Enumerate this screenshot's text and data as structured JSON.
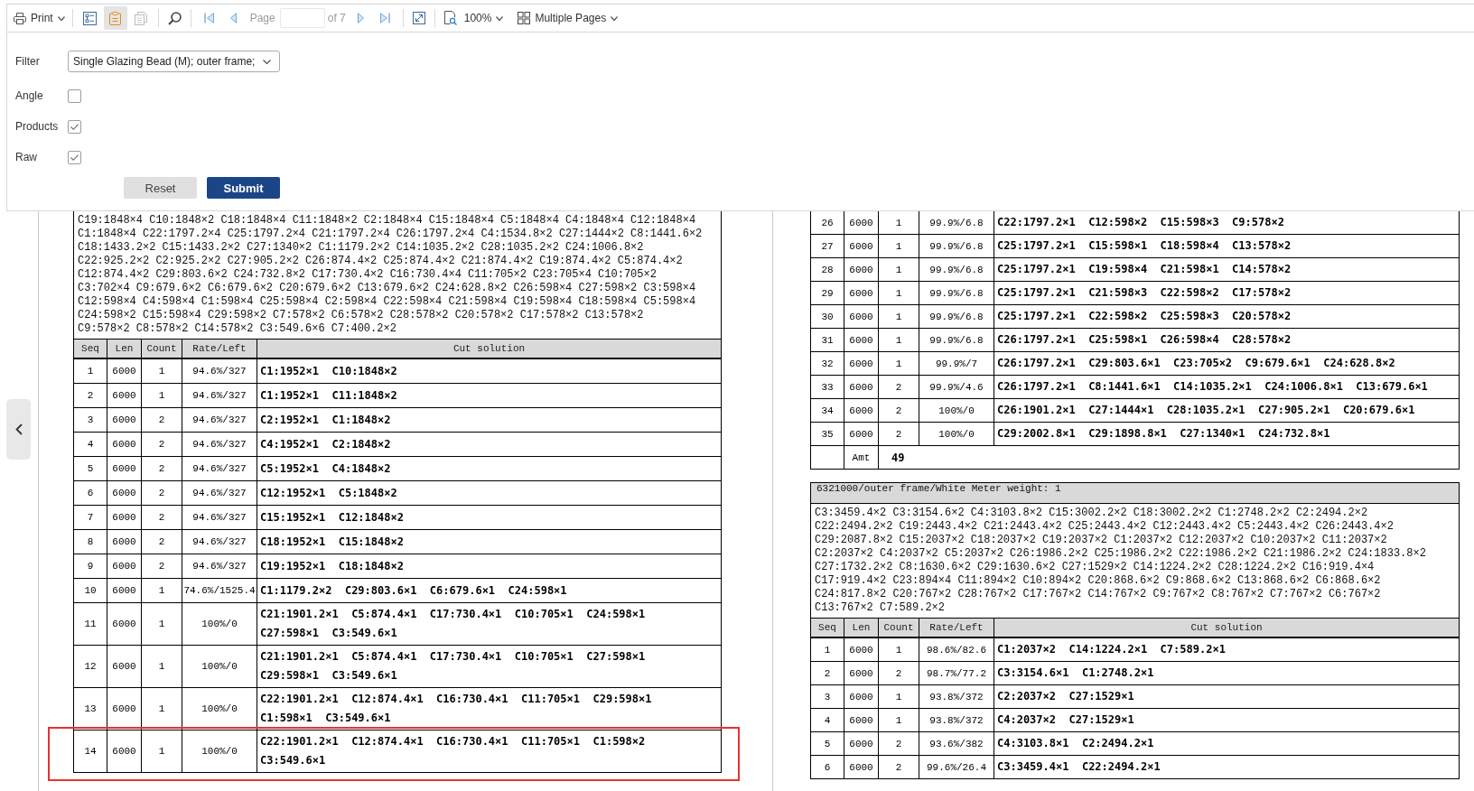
{
  "toolbar": {
    "print": "Print",
    "group_buttons": [
      {
        "selected": false,
        "disabled": false
      },
      {
        "selected": true,
        "disabled": false
      },
      {
        "selected": false,
        "disabled": true
      }
    ],
    "page_label": "Page",
    "page_count": "of 7",
    "zoom": "100%",
    "view_mode": "Multiple Pages"
  },
  "filter_panel": {
    "fields": [
      {
        "label": "Filter",
        "kind": "dropdown",
        "value": "Single Glazing Bead (M); outer frame;"
      },
      {
        "label": "Angle",
        "kind": "checkbox",
        "checked": false
      },
      {
        "label": "Products",
        "kind": "checkbox",
        "checked": true
      },
      {
        "label": "Raw",
        "kind": "checkbox",
        "checked": true
      }
    ],
    "buttons": [
      {
        "label": "Reset",
        "kind": "secondary"
      },
      {
        "label": "Submit",
        "kind": "primary"
      }
    ]
  },
  "left_page": {
    "raw_list": {
      "lines": [
        "C19:1848×4 C10:1848×2 C18:1848×4 C11:1848×2 C2:1848×4 C15:1848×4 C5:1848×4 C4:1848×4 C12:1848×4",
        "C1:1848×4 C22:1797.2×4 C25:1797.2×4 C21:1797.2×4 C26:1797.2×4 C4:1534.8×2 C27:1444×2 C8:1441.6×2",
        "C18:1433.2×2 C15:1433.2×2 C27:1340×2 C1:1179.2×2 C14:1035.2×2 C28:1035.2×2 C24:1006.8×2",
        "C22:925.2×2 C2:925.2×2 C27:905.2×2 C26:874.4×2 C25:874.4×2 C21:874.4×2 C19:874.4×2 C5:874.4×2",
        "C12:874.4×2 C29:803.6×2 C24:732.8×2 C17:730.4×2 C16:730.4×4 C11:705×2 C23:705×4 C10:705×2",
        "C3:702×4 C9:679.6×2 C6:679.6×2 C20:679.6×2 C13:679.6×2 C24:628.8×2 C26:598×4 C27:598×2 C3:598×4",
        "C12:598×4 C4:598×4 C1:598×4 C25:598×4 C2:598×4 C22:598×4 C21:598×4 C19:598×4 C18:598×4 C5:598×4",
        "C24:598×2 C15:598×4 C29:598×2 C7:578×2 C6:578×2 C28:578×2 C20:578×2 C17:578×2 C13:578×2",
        "C9:578×2 C8:578×2 C14:578×2 C3:549.6×6 C7:400.2×2"
      ]
    },
    "table": {
      "columns": [
        "Seq",
        "Len",
        "Count",
        "Rate/Left",
        "Cut solution"
      ],
      "rows": [
        {
          "seq": "1",
          "len": "6000",
          "count": "1",
          "rate_left": "94.6%/327",
          "cut_solution": [
            "C1:1952×1  C10:1848×2"
          ],
          "highlighted": false
        },
        {
          "seq": "2",
          "len": "6000",
          "count": "1",
          "rate_left": "94.6%/327",
          "cut_solution": [
            "C1:1952×1  C11:1848×2"
          ],
          "highlighted": false
        },
        {
          "seq": "3",
          "len": "6000",
          "count": "2",
          "rate_left": "94.6%/327",
          "cut_solution": [
            "C2:1952×1  C1:1848×2"
          ],
          "highlighted": false
        },
        {
          "seq": "4",
          "len": "6000",
          "count": "2",
          "rate_left": "94.6%/327",
          "cut_solution": [
            "C4:1952×1  C2:1848×2"
          ],
          "highlighted": false
        },
        {
          "seq": "5",
          "len": "6000",
          "count": "2",
          "rate_left": "94.6%/327",
          "cut_solution": [
            "C5:1952×1  C4:1848×2"
          ],
          "highlighted": false
        },
        {
          "seq": "6",
          "len": "6000",
          "count": "2",
          "rate_left": "94.6%/327",
          "cut_solution": [
            "C12:1952×1  C5:1848×2"
          ],
          "highlighted": false
        },
        {
          "seq": "7",
          "len": "6000",
          "count": "2",
          "rate_left": "94.6%/327",
          "cut_solution": [
            "C15:1952×1  C12:1848×2"
          ],
          "highlighted": false
        },
        {
          "seq": "8",
          "len": "6000",
          "count": "2",
          "rate_left": "94.6%/327",
          "cut_solution": [
            "C18:1952×1  C15:1848×2"
          ],
          "highlighted": false
        },
        {
          "seq": "9",
          "len": "6000",
          "count": "2",
          "rate_left": "94.6%/327",
          "cut_solution": [
            "C19:1952×1  C18:1848×2"
          ],
          "highlighted": false
        },
        {
          "seq": "10",
          "len": "6000",
          "count": "1",
          "rate_left": "74.6%/1525.4",
          "cut_solution": [
            "C1:1179.2×2  C29:803.6×1  C6:679.6×1  C24:598×1"
          ],
          "highlighted": false
        },
        {
          "seq": "11",
          "len": "6000",
          "count": "1",
          "rate_left": "100%/0",
          "cut_solution": [
            "C21:1901.2×1  C5:874.4×1  C17:730.4×1  C10:705×1  C24:598×1",
            "C27:598×1  C3:549.6×1"
          ],
          "highlighted": false
        },
        {
          "seq": "12",
          "len": "6000",
          "count": "1",
          "rate_left": "100%/0",
          "cut_solution": [
            "C21:1901.2×1  C5:874.4×1  C17:730.4×1  C10:705×1  C27:598×1",
            "C29:598×1  C3:549.6×1"
          ],
          "highlighted": false
        },
        {
          "seq": "13",
          "len": "6000",
          "count": "1",
          "rate_left": "100%/0",
          "cut_solution": [
            "C22:1901.2×1  C12:874.4×1  C16:730.4×1  C11:705×1  C29:598×1",
            "C1:598×1  C3:549.6×1"
          ],
          "highlighted": false
        },
        {
          "seq": "14",
          "len": "6000",
          "count": "1",
          "rate_left": "100%/0",
          "cut_solution": [
            "C22:1901.2×1  C12:874.4×1  C16:730.4×1  C11:705×1  C1:598×2",
            "C3:549.6×1"
          ],
          "highlighted": true
        }
      ]
    }
  },
  "right_page": {
    "table": {
      "rows": [
        {
          "seq": "26",
          "len": "6000",
          "count": "1",
          "rate_left": "99.9%/6.8",
          "cut_solution": [
            "C22:1797.2×1  C12:598×2  C15:598×3  C9:578×2"
          ]
        },
        {
          "seq": "27",
          "len": "6000",
          "count": "1",
          "rate_left": "99.9%/6.8",
          "cut_solution": [
            "C25:1797.2×1  C15:598×1  C18:598×4  C13:578×2"
          ]
        },
        {
          "seq": "28",
          "len": "6000",
          "count": "1",
          "rate_left": "99.9%/6.8",
          "cut_solution": [
            "C25:1797.2×1  C19:598×4  C21:598×1  C14:578×2"
          ]
        },
        {
          "seq": "29",
          "len": "6000",
          "count": "1",
          "rate_left": "99.9%/6.8",
          "cut_solution": [
            "C25:1797.2×1  C21:598×3  C22:598×2  C17:578×2"
          ]
        },
        {
          "seq": "30",
          "len": "6000",
          "count": "1",
          "rate_left": "99.9%/6.8",
          "cut_solution": [
            "C25:1797.2×1  C22:598×2  C25:598×3  C20:578×2"
          ]
        },
        {
          "seq": "31",
          "len": "6000",
          "count": "1",
          "rate_left": "99.9%/6.8",
          "cut_solution": [
            "C26:1797.2×1  C25:598×1  C26:598×4  C28:578×2"
          ]
        },
        {
          "seq": "32",
          "len": "6000",
          "count": "1",
          "rate_left": "99.9%/7",
          "cut_solution": [
            "C26:1797.2×1  C29:803.6×1  C23:705×2  C9:679.6×1  C24:628.8×2"
          ]
        },
        {
          "seq": "33",
          "len": "6000",
          "count": "2",
          "rate_left": "99.9%/4.6",
          "cut_solution": [
            "C26:1797.2×1  C8:1441.6×1  C14:1035.2×1  C24:1006.8×1  C13:679.6×1"
          ]
        },
        {
          "seq": "34",
          "len": "6000",
          "count": "2",
          "rate_left": "100%/0",
          "cut_solution": [
            "C26:1901.2×1  C27:1444×1  C28:1035.2×1  C27:905.2×1  C20:679.6×1"
          ]
        },
        {
          "seq": "35",
          "len": "6000",
          "count": "2",
          "rate_left": "100%/0",
          "cut_solution": [
            "C29:2002.8×1  C29:1898.8×1  C27:1340×1  C24:732.8×1"
          ]
        }
      ],
      "total": {
        "label": "Amt",
        "value": "49"
      }
    },
    "section": {
      "title": "6321000/outer frame/White Meter weight: 1",
      "raw_list": {
        "lines": [
          "C3:3459.4×2 C3:3154.6×2 C4:3103.8×2 C15:3002.2×2 C18:3002.2×2 C1:2748.2×2 C2:2494.2×2",
          "C22:2494.2×2 C19:2443.4×2 C21:2443.4×2 C25:2443.4×2 C12:2443.4×2 C5:2443.4×2 C26:2443.4×2",
          "C29:2087.8×2 C15:2037×2 C18:2037×2 C19:2037×2 C1:2037×2 C12:2037×2 C10:2037×2 C11:2037×2",
          "C2:2037×2 C4:2037×2 C5:2037×2 C26:1986.2×2 C25:1986.2×2 C22:1986.2×2 C21:1986.2×2 C24:1833.8×2",
          "C27:1732.2×2 C8:1630.6×2 C29:1630.6×2 C27:1529×2 C14:1224.2×2 C28:1224.2×2 C16:919.4×4",
          "C17:919.4×2 C23:894×4 C11:894×2 C10:894×2 C20:868.6×2 C9:868.6×2 C13:868.6×2 C6:868.6×2",
          "C24:817.8×2 C20:767×2 C28:767×2 C17:767×2 C14:767×2 C9:767×2 C8:767×2 C7:767×2 C6:767×2",
          "C13:767×2 C7:589.2×2"
        ]
      },
      "table": {
        "columns": [
          "Seq",
          "Len",
          "Count",
          "Rate/Left",
          "Cut solution"
        ],
        "rows": [
          {
            "seq": "1",
            "len": "6000",
            "count": "1",
            "rate_left": "98.6%/82.6",
            "cut_solution": [
              "C1:2037×2  C14:1224.2×1  C7:589.2×1"
            ]
          },
          {
            "seq": "2",
            "len": "6000",
            "count": "2",
            "rate_left": "98.7%/77.2",
            "cut_solution": [
              "C3:3154.6×1  C1:2748.2×1"
            ]
          },
          {
            "seq": "3",
            "len": "6000",
            "count": "1",
            "rate_left": "93.8%/372",
            "cut_solution": [
              "C2:2037×2  C27:1529×1"
            ]
          },
          {
            "seq": "4",
            "len": "6000",
            "count": "1",
            "rate_left": "93.8%/372",
            "cut_solution": [
              "C4:2037×2  C27:1529×1"
            ]
          },
          {
            "seq": "5",
            "len": "6000",
            "count": "2",
            "rate_left": "93.6%/382",
            "cut_solution": [
              "C4:3103.8×1  C2:2494.2×1"
            ]
          },
          {
            "seq": "6",
            "len": "6000",
            "count": "2",
            "rate_left": "99.6%/26.4",
            "cut_solution": [
              "C3:3459.4×1  C22:2494.2×1"
            ]
          }
        ]
      }
    }
  }
}
